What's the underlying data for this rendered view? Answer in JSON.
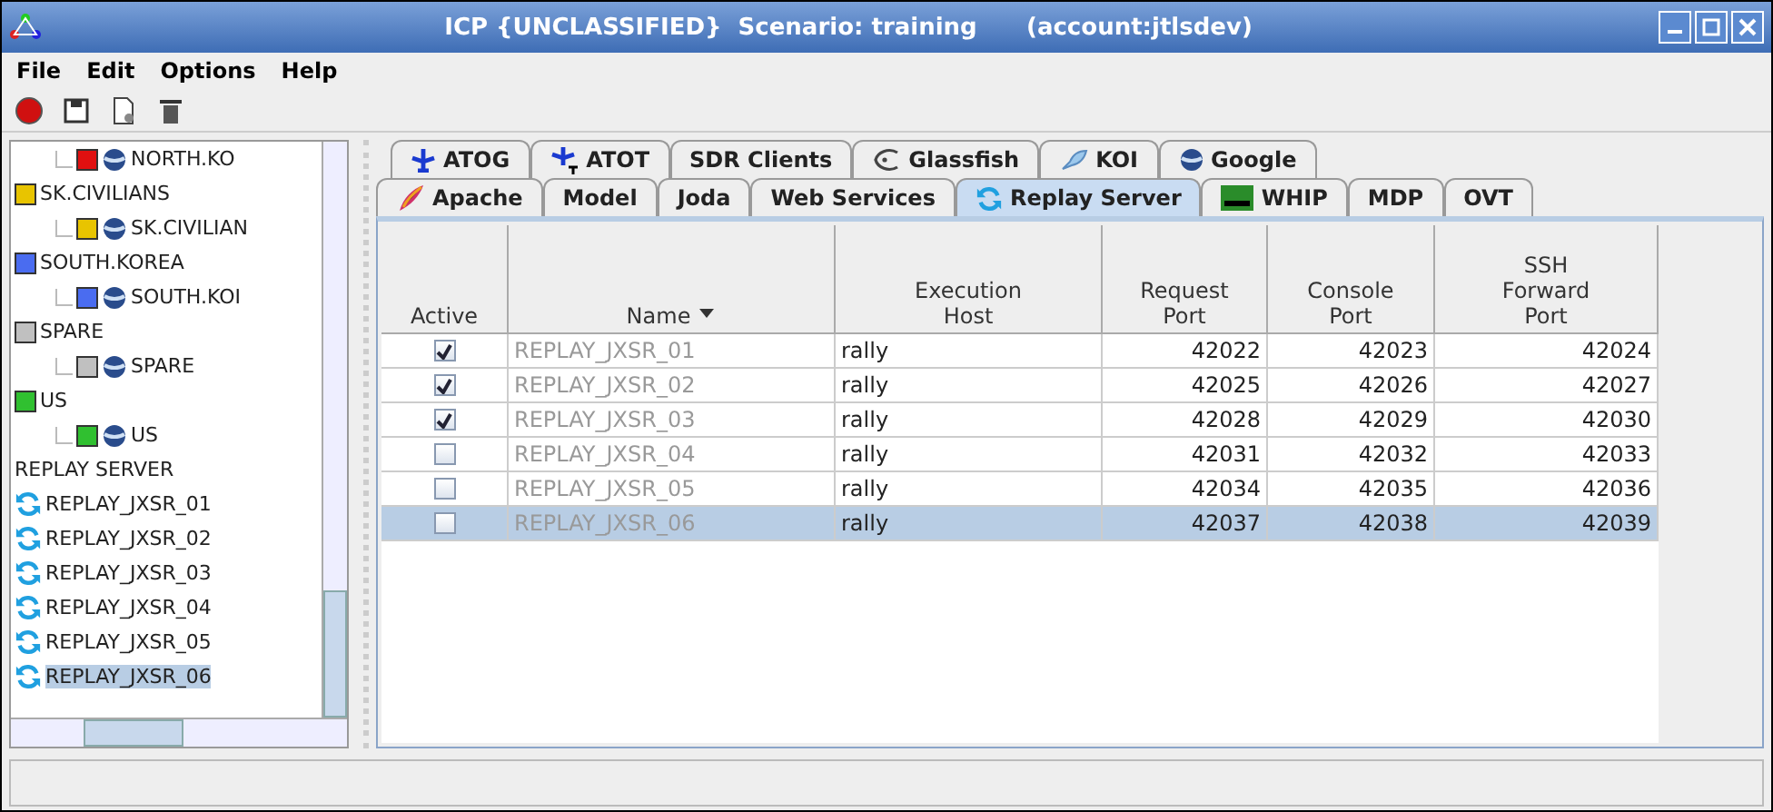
{
  "window": {
    "title": "ICP {UNCLASSIFIED}  Scenario: training      (account:jtlsdev)"
  },
  "menu": [
    "File",
    "Edit",
    "Options",
    "Help"
  ],
  "tree": [
    {
      "label": "NORTH.KO",
      "kind": "leaf",
      "color": "#e01010",
      "selected": false
    },
    {
      "label": "SK.CIVILIANS",
      "kind": "group",
      "color": "#e8c400",
      "selected": false,
      "children": [
        {
          "label": "SK.CIVILIAN",
          "kind": "leaf",
          "color": "#e8c400",
          "selected": false
        }
      ]
    },
    {
      "label": "SOUTH.KOREA",
      "kind": "group",
      "color": "#4a6cf0",
      "selected": false,
      "children": [
        {
          "label": "SOUTH.KOI",
          "kind": "leaf",
          "color": "#4a6cf0",
          "selected": false
        }
      ]
    },
    {
      "label": "SPARE",
      "kind": "group",
      "color": "#c0c0c0",
      "selected": false,
      "children": [
        {
          "label": "SPARE",
          "kind": "leaf",
          "color": "#c0c0c0",
          "selected": false
        }
      ]
    },
    {
      "label": "US",
      "kind": "group",
      "color": "#30c030",
      "selected": false,
      "children": [
        {
          "label": "US",
          "kind": "leaf",
          "color": "#30c030",
          "selected": false
        }
      ]
    },
    {
      "label": "REPLAY SERVER",
      "kind": "heading",
      "selected": false,
      "children": [
        {
          "label": "REPLAY_JXSR_01",
          "kind": "server",
          "selected": false
        },
        {
          "label": "REPLAY_JXSR_02",
          "kind": "server",
          "selected": false
        },
        {
          "label": "REPLAY_JXSR_03",
          "kind": "server",
          "selected": false
        },
        {
          "label": "REPLAY_JXSR_04",
          "kind": "server",
          "selected": false
        },
        {
          "label": "REPLAY_JXSR_05",
          "kind": "server",
          "selected": false
        },
        {
          "label": "REPLAY_JXSR_06",
          "kind": "server",
          "selected": true
        }
      ]
    }
  ],
  "tab_rows": [
    [
      {
        "label": "ATOG",
        "selected": false
      },
      {
        "label": "ATOT",
        "selected": false
      },
      {
        "label": "SDR Clients",
        "selected": false
      },
      {
        "label": "Glassfish",
        "selected": false
      },
      {
        "label": "KOI",
        "selected": false
      },
      {
        "label": "Google",
        "selected": false
      }
    ],
    [
      {
        "label": "Apache",
        "selected": false
      },
      {
        "label": "Model",
        "selected": false
      },
      {
        "label": "Joda",
        "selected": false
      },
      {
        "label": "Web Services",
        "selected": false
      },
      {
        "label": "Replay Server",
        "selected": true
      },
      {
        "label": "WHIP",
        "selected": false
      },
      {
        "label": "MDP",
        "selected": false
      },
      {
        "label": "OVT",
        "selected": false
      }
    ]
  ],
  "table": {
    "columns": [
      {
        "label": "Active"
      },
      {
        "label": "Name",
        "sorted": true
      },
      {
        "label": "Execution Host"
      },
      {
        "label": "Request Port"
      },
      {
        "label": "Console Port"
      },
      {
        "label": "SSH Forward Port"
      }
    ],
    "rows": [
      {
        "active": true,
        "name": "REPLAY_JXSR_01",
        "host": "rally",
        "request": "42022",
        "console": "42023",
        "ssh": "42024",
        "selected": false
      },
      {
        "active": true,
        "name": "REPLAY_JXSR_02",
        "host": "rally",
        "request": "42025",
        "console": "42026",
        "ssh": "42027",
        "selected": false
      },
      {
        "active": true,
        "name": "REPLAY_JXSR_03",
        "host": "rally",
        "request": "42028",
        "console": "42029",
        "ssh": "42030",
        "selected": false
      },
      {
        "active": false,
        "name": "REPLAY_JXSR_04",
        "host": "rally",
        "request": "42031",
        "console": "42032",
        "ssh": "42033",
        "selected": false
      },
      {
        "active": false,
        "name": "REPLAY_JXSR_05",
        "host": "rally",
        "request": "42034",
        "console": "42035",
        "ssh": "42036",
        "selected": false
      },
      {
        "active": false,
        "name": "REPLAY_JXSR_06",
        "host": "rally",
        "request": "42037",
        "console": "42038",
        "ssh": "42039",
        "selected": true
      }
    ]
  }
}
